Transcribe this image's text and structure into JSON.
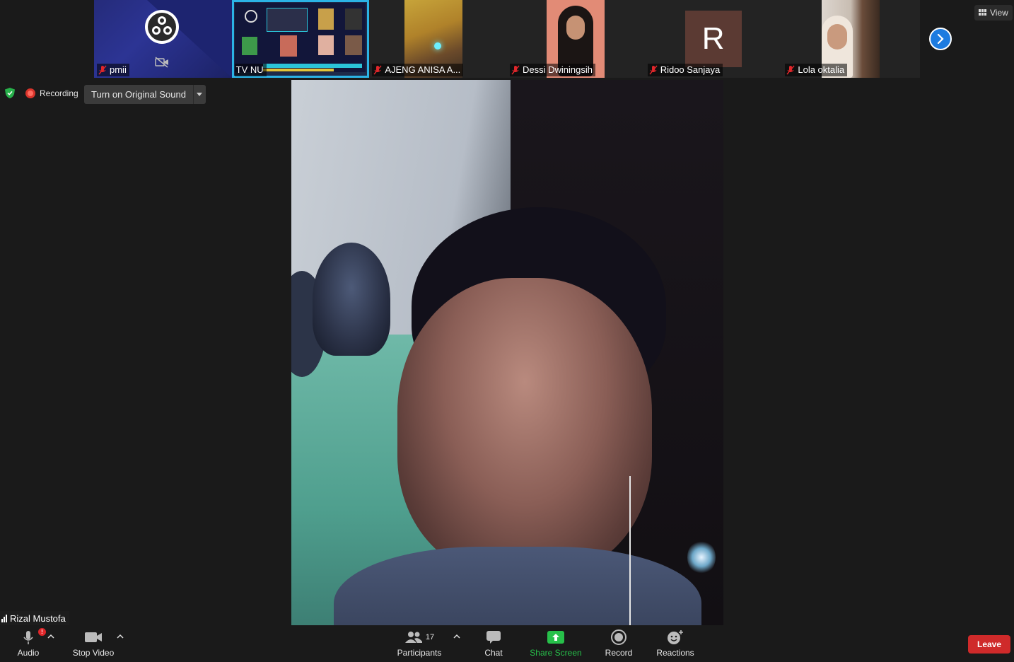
{
  "participants_strip": [
    {
      "name": "pmii",
      "muted": true,
      "video": "off"
    },
    {
      "name": "TV NU",
      "muted": false,
      "video": "screen-share",
      "active": true
    },
    {
      "name": "AJENG ANISA A...",
      "muted": true,
      "video": "on"
    },
    {
      "name": "Dessi Dwiningsih",
      "muted": true,
      "video": "on"
    },
    {
      "name": "Ridoo Sanjaya",
      "muted": true,
      "video": "avatar",
      "avatar_letter": "R"
    },
    {
      "name": "Lola oktalia",
      "muted": true,
      "video": "on"
    }
  ],
  "view_button": {
    "label": "View"
  },
  "recording": {
    "label": "Recording"
  },
  "original_sound": {
    "label": "Turn on Original Sound"
  },
  "speaker": {
    "name": "Rizal Mustofa"
  },
  "toolbar": {
    "audio": "Audio",
    "stop_video": "Stop Video",
    "participants": "Participants",
    "participants_count": "17",
    "chat": "Chat",
    "share_screen": "Share Screen",
    "record": "Record",
    "reactions": "Reactions",
    "leave": "Leave",
    "audio_badge": "!"
  },
  "colors": {
    "background": "#1a1a1a",
    "active_border": "#2bb3e6",
    "share_green": "#27c04a",
    "leave_red": "#cf2a2a",
    "next_blue": "#1c7be0"
  }
}
